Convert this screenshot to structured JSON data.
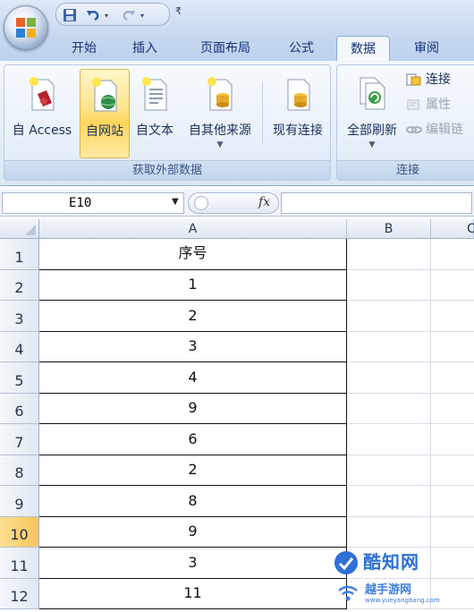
{
  "quick_access": {
    "save_icon": "save-icon",
    "undo_icon": "undo-icon",
    "redo_icon": "redo-icon",
    "customize": "₹"
  },
  "tabs": [
    {
      "label": "开始"
    },
    {
      "label": "插入"
    },
    {
      "label": "页面布局"
    },
    {
      "label": "公式"
    },
    {
      "label": "数据",
      "active": true
    },
    {
      "label": "审阅"
    }
  ],
  "ribbon": {
    "group_external": {
      "label": "获取外部数据",
      "buttons": [
        {
          "label": "自 Access"
        },
        {
          "label": "自网站"
        },
        {
          "label": "自文本"
        },
        {
          "label": "自其他来源"
        },
        {
          "label": "现有连接"
        }
      ]
    },
    "group_connections": {
      "label": "连接",
      "refresh_label": "全部刷新",
      "small": [
        {
          "label": "连接"
        },
        {
          "label": "属性"
        },
        {
          "label": "编辑链"
        }
      ]
    }
  },
  "formula_bar": {
    "name_box": "E10",
    "fx": "fx",
    "value": ""
  },
  "columns": {
    "a": "A",
    "b": "B",
    "c": "C"
  },
  "rows": [
    {
      "n": "1",
      "a": "序号"
    },
    {
      "n": "2",
      "a": "1"
    },
    {
      "n": "3",
      "a": "2"
    },
    {
      "n": "4",
      "a": "3"
    },
    {
      "n": "5",
      "a": "4"
    },
    {
      "n": "6",
      "a": "9"
    },
    {
      "n": "7",
      "a": "6"
    },
    {
      "n": "8",
      "a": "2"
    },
    {
      "n": "9",
      "a": "8"
    },
    {
      "n": "10",
      "a": "9",
      "selected": true
    },
    {
      "n": "11",
      "a": "3"
    },
    {
      "n": "12",
      "a": "11"
    }
  ],
  "watermark": {
    "main": "酷知网",
    "sub": "越手游网",
    "url": "www.yueyangbang.com"
  },
  "colors": {
    "accent": "#15317a",
    "selected_row": "#f8c55c",
    "ribbon_bg": "#dbe7f5"
  }
}
